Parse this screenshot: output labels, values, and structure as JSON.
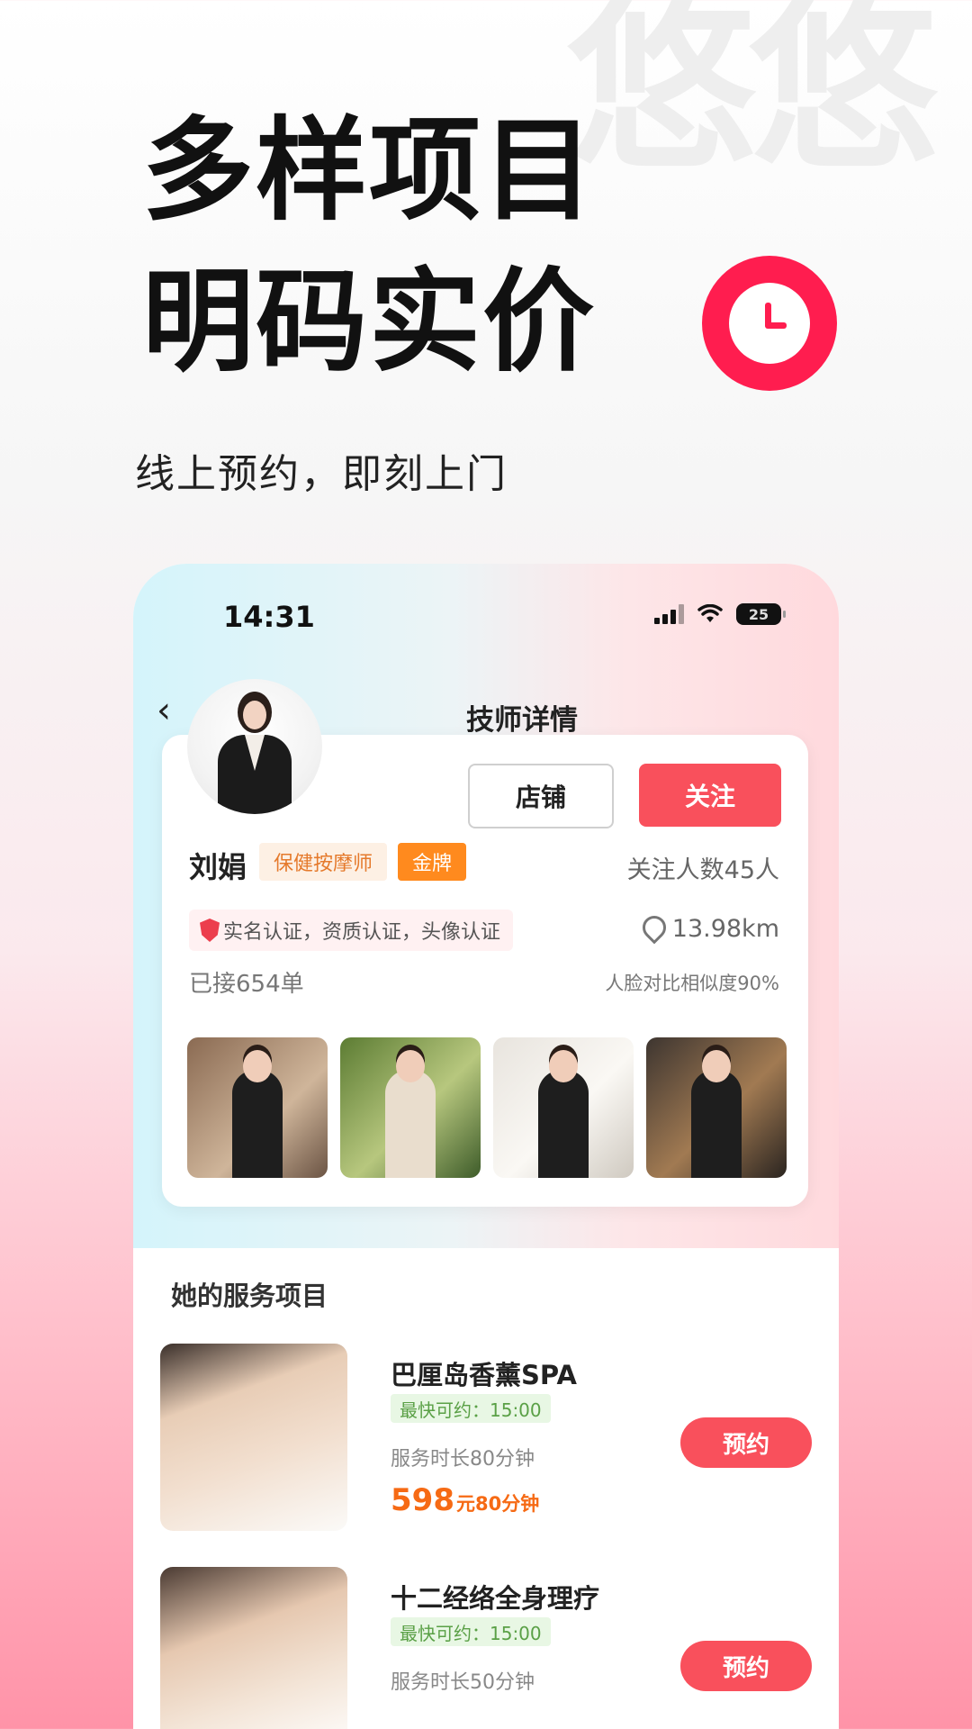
{
  "watermark": "悠悠",
  "headline": {
    "line1": "多样项目",
    "line2": "明码实价"
  },
  "subline": "线上预约，即刻上门",
  "phone": {
    "status": {
      "time": "14:31",
      "battery": "25"
    },
    "page_title": "技师详情",
    "profile": {
      "store_label": "店铺",
      "follow_label": "关注",
      "name": "刘娟",
      "role_tag": "保健按摩师",
      "level_tag": "金牌",
      "followers": "关注人数45人",
      "certifications": "实名认证，资质认证，头像认证",
      "distance": "13.98km",
      "orders": "已接654单",
      "face_similarity": "人脸对比相似度90%"
    },
    "services_title": "她的服务项目",
    "services": [
      {
        "name": "巴厘岛香薰SPA",
        "available": "最快可约：15:00",
        "duration": "服务时长80分钟",
        "price": "598",
        "price_unit": "元80分钟",
        "book_label": "预约"
      },
      {
        "name": "十二经络全身理疗",
        "available": "最快可约：15:00",
        "duration": "服务时长50分钟",
        "book_label": "预约"
      }
    ]
  }
}
